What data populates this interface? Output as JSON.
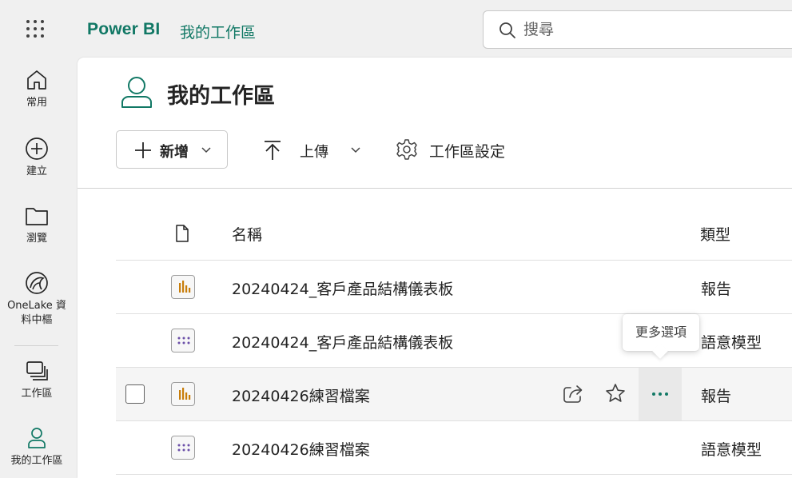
{
  "header": {
    "app_name": "Power BI",
    "workspace_link": "我的工作區",
    "search_placeholder": "搜尋"
  },
  "nav": {
    "items": [
      {
        "label": "常用",
        "icon": "home-icon"
      },
      {
        "label": "建立",
        "icon": "create-icon"
      },
      {
        "label": "瀏覽",
        "icon": "folder-icon"
      },
      {
        "label": "OneLake 資料中樞",
        "label_line1": "OneLake 資",
        "label_line2": "料中樞",
        "icon": "onelake-icon"
      },
      {
        "label": "工作區",
        "icon": "workspaces-icon"
      },
      {
        "label": "我的工作區",
        "icon": "person-icon"
      }
    ]
  },
  "workspace": {
    "title": "我的工作區",
    "toolbar": {
      "new_label": "新增",
      "upload_label": "上傳",
      "settings_label": "工作區設定"
    }
  },
  "table": {
    "columns": {
      "name": "名稱",
      "type": "類型"
    },
    "rows": [
      {
        "name": "20240424_客戶產品結構儀表板",
        "type": "報告",
        "icon": "report-icon"
      },
      {
        "name": "20240424_客戶產品結構儀表板",
        "type": "語意模型",
        "icon": "semantic-model-icon"
      },
      {
        "name": "20240426練習檔案",
        "type": "報告",
        "icon": "report-icon"
      },
      {
        "name": "20240426練習檔案",
        "type": "語意模型",
        "icon": "semantic-model-icon"
      }
    ]
  },
  "tooltip": {
    "text": "更多選項"
  },
  "colors": {
    "brand": "#117865",
    "report_bar": "#c87d0a",
    "model_dots": "#6b4fa8",
    "background": "#f0f0f0"
  }
}
